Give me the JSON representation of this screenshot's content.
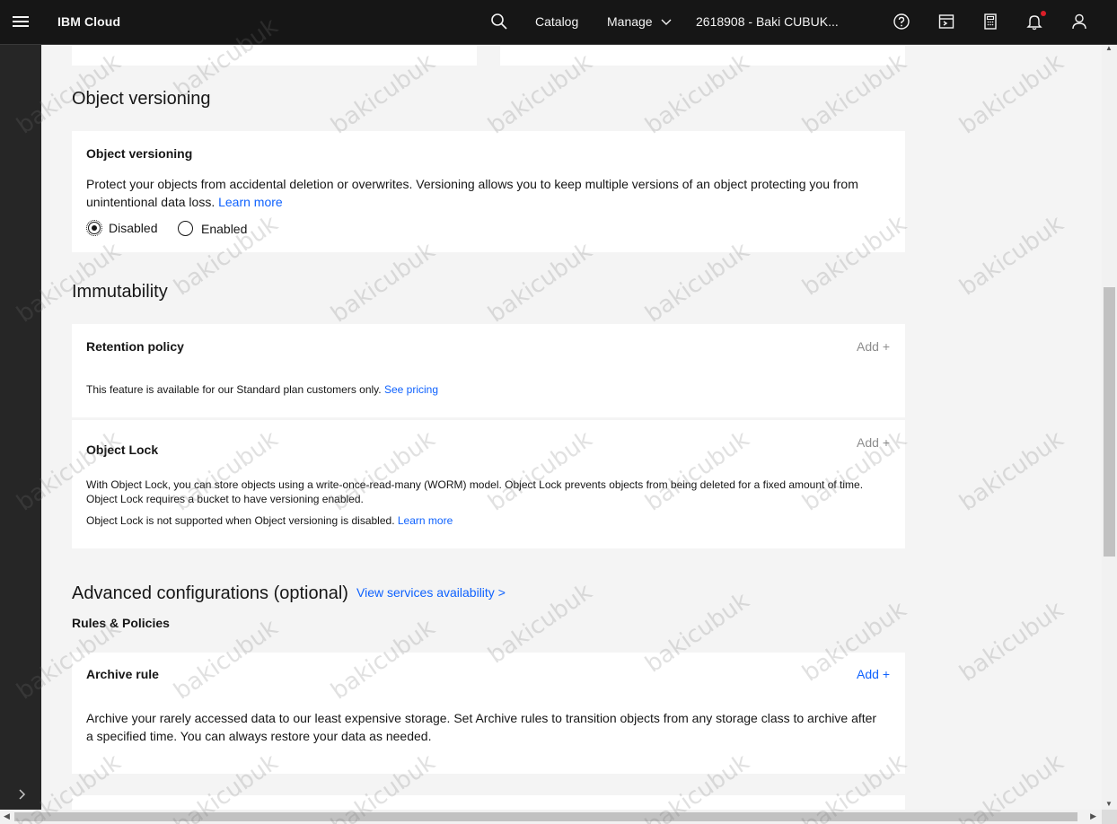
{
  "header": {
    "brand": "IBM Cloud",
    "catalog": "Catalog",
    "manage": "Manage",
    "account": "2618908 - Baki CUBUK...",
    "icons": [
      "menu-icon",
      "search-icon",
      "chevron-down-icon",
      "help-icon",
      "cost-estimator-icon",
      "calculator-icon",
      "notification-icon",
      "user-icon"
    ]
  },
  "versioning": {
    "section_title": "Object versioning",
    "card_title": "Object versioning",
    "description": "Protect your objects from accidental deletion or overwrites. Versioning allows you to keep multiple versions of an object protecting you from unintentional data loss.",
    "learn_more": "Learn more",
    "options": [
      {
        "label": "Disabled",
        "selected": true
      },
      {
        "label": "Enabled",
        "selected": false
      }
    ]
  },
  "immutability": {
    "section_title": "Immutability",
    "retention": {
      "title": "Retention policy",
      "add": "Add +",
      "text": "This feature is available for our Standard plan customers only.",
      "link": "See pricing"
    },
    "object_lock": {
      "title": "Object Lock",
      "add": "Add +",
      "text": "With Object Lock, you can store objects using a write-once-read-many (WORM) model. Object Lock prevents objects from being deleted for a fixed amount of time. Object Lock requires a bucket to have versioning enabled.",
      "note": "Object Lock is not supported when Object versioning is disabled.",
      "link": "Learn more"
    }
  },
  "advanced": {
    "section_title": "Advanced configurations (optional)",
    "services_link": "View services availability >",
    "subheading": "Rules & Policies",
    "archive": {
      "title": "Archive rule",
      "add": "Add +",
      "text": "Archive your rarely accessed data to our least expensive storage. Set Archive rules to transition objects from any storage class to archive after a specified time. You can always restore your data as needed."
    }
  },
  "watermark": "bakicubuk",
  "colors": {
    "header_bg": "#161616",
    "page_bg": "#f4f4f4",
    "card_bg": "#ffffff",
    "link": "#0f62fe",
    "disabled_link": "#8d8d8d",
    "notification_dot": "#da1e28"
  }
}
